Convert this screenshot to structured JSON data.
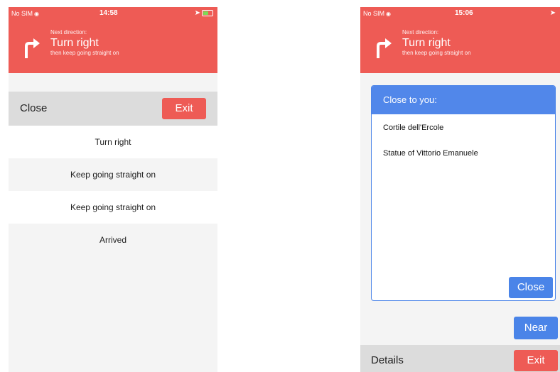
{
  "left": {
    "status": {
      "carrier": "No SIM",
      "time": "14:58"
    },
    "direction": {
      "label": "Next direction:",
      "title": "Turn right",
      "subtitle": "then keep going straight on"
    },
    "toolbar": {
      "close_label": "Close",
      "exit_label": "Exit"
    },
    "steps": [
      "Turn right",
      "Keep going straight on",
      "Keep going straight on",
      "Arrived"
    ]
  },
  "right": {
    "status": {
      "carrier": "No SIM",
      "time": "15:06"
    },
    "direction": {
      "label": "Next direction:",
      "title": "Turn right",
      "subtitle": "then keep going straight on"
    },
    "modal": {
      "title": "Close to you:",
      "items": [
        "Cortile dell'Ercole",
        "Statue of Vittorio Emanuele"
      ],
      "close_label": "Close"
    },
    "near_label": "Near",
    "details_label": "Details",
    "exit_label": "Exit"
  },
  "colors": {
    "header": "#EE5B55",
    "accent_blue": "#4A84E8",
    "exit": "#EE5B55"
  },
  "icons": {
    "turn": "turn-right-arrow-icon",
    "location": "location-arrow-icon",
    "battery": "battery-charging-icon"
  }
}
